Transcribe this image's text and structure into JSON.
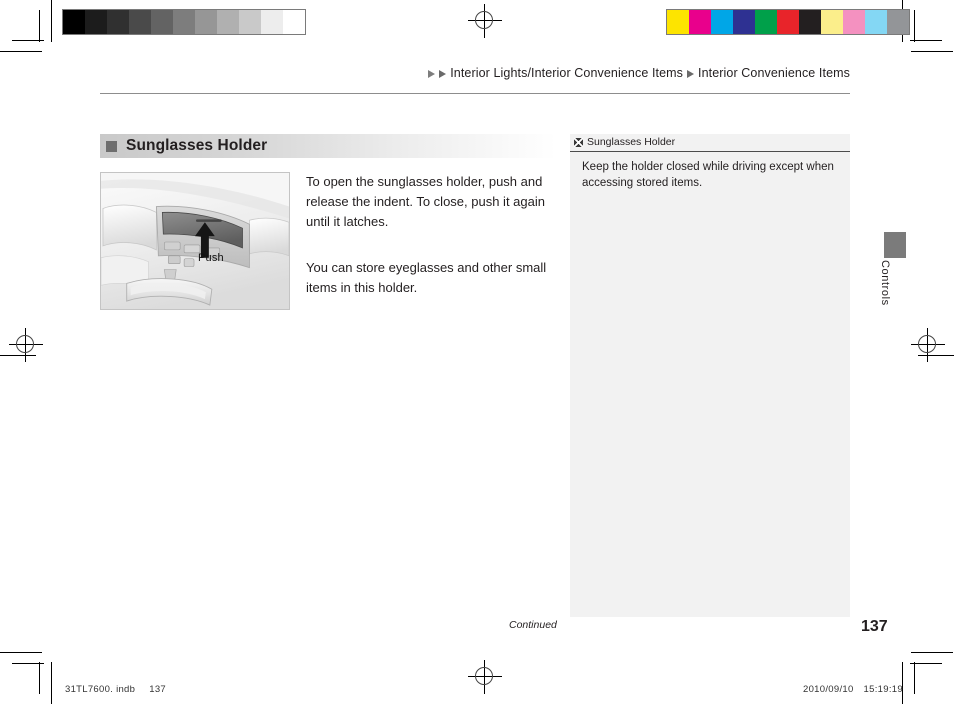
{
  "header": {
    "breadcrumb_1": "Interior Lights/Interior Convenience Items",
    "breadcrumb_2": "Interior Convenience Items"
  },
  "section": {
    "title": "Sunglasses Holder"
  },
  "figure": {
    "caption": "Push",
    "alt_name": "overhead-console-sunglasses-holder-photo"
  },
  "body": {
    "paragraph_1": "To open the sunglasses holder, push and release the indent. To close, push it again until it latches.",
    "paragraph_2": "You can store eyeglasses and other small items in this holder."
  },
  "note": {
    "title": "Sunglasses Holder",
    "text": "Keep the holder closed while driving except when accessing stored items."
  },
  "thumb_tab": {
    "label": "Controls"
  },
  "footer": {
    "continued": "Continued",
    "page_number": "137"
  },
  "print_marks": {
    "file_name": "31TL7600. indb",
    "file_page": "137",
    "date": "2010/09/10",
    "time": "15:19:19"
  },
  "calibration": {
    "grayscale_swatches": [
      "#000000",
      "#1c1c1c",
      "#303030",
      "#4a4a4a",
      "#636363",
      "#7d7d7d",
      "#969696",
      "#b0b0b0",
      "#c9c9c9",
      "#ededed",
      "#ffffff"
    ],
    "color_swatches": [
      "#fde400",
      "#e9008c",
      "#00a6e7",
      "#2e3192",
      "#00a04a",
      "#e8242a",
      "#231f20",
      "#fbee8b",
      "#f491c0",
      "#84d7f4",
      "#939598"
    ]
  }
}
